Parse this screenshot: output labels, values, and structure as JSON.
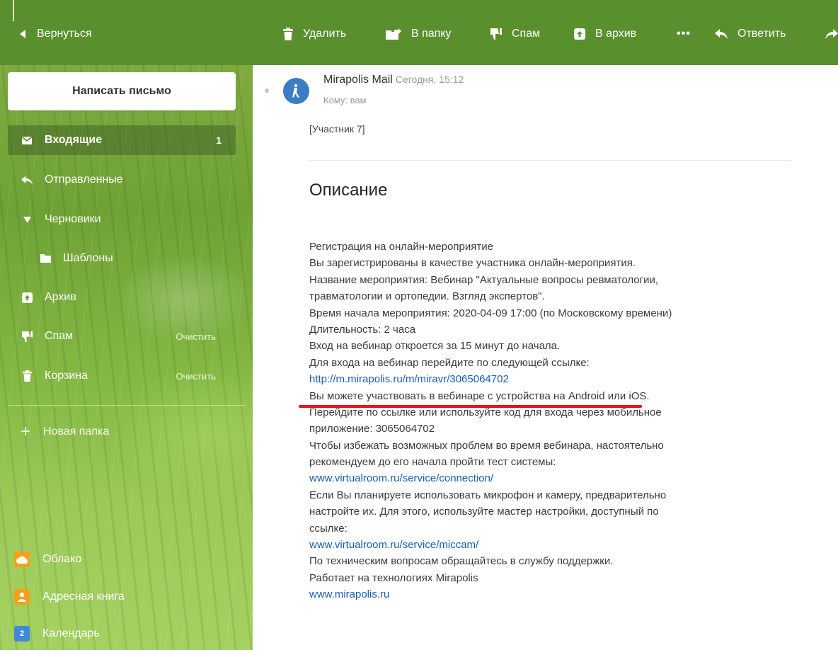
{
  "toolbar": {
    "back_label": "Вернуться",
    "delete_label": "Удалить",
    "folder_label": "В папку",
    "spam_label": "Спам",
    "archive_label": "В архив",
    "more_label": "•••",
    "reply_label": "Ответить"
  },
  "sidebar": {
    "compose_label": "Написать письмо",
    "folders": [
      {
        "label": "Входящие",
        "count": "1",
        "icon": "envelope-icon"
      },
      {
        "label": "Отправленные",
        "icon": "reply-arrow-icon"
      },
      {
        "label": "Черновики",
        "icon": "triangle-down-icon"
      },
      {
        "label": "Шаблоны",
        "icon": "folder-icon"
      },
      {
        "label": "Архив",
        "icon": "archive-icon"
      },
      {
        "label": "Спам",
        "clear": "Очистить",
        "icon": "thumb-down-icon"
      },
      {
        "label": "Корзина",
        "clear": "Очистить",
        "icon": "trash-icon"
      }
    ],
    "new_folder_label": "Новая папка",
    "apps": [
      {
        "label": "Облако",
        "color": "#f5a01a",
        "icon": "cloud-icon"
      },
      {
        "label": "Адресная книга",
        "color": "#f5a01a",
        "icon": "contact-icon"
      },
      {
        "label": "Календарь",
        "color": "#3f8ad8",
        "icon": "calendar-icon",
        "glyph": "2"
      }
    ]
  },
  "message": {
    "sender": "Mirapolis Mail",
    "date": "Сегодня, 15:12",
    "to": "Кому: вам",
    "participant": "[Участник 7]",
    "heading": "Описание",
    "lines": [
      "Регистрация на онлайн-мероприятие",
      "Вы зарегистрированы в качестве участника онлайн-мероприятия.",
      "Название мероприятия: Вебинар \"Актуальные вопросы ревматологии,",
      "травматологии и ортопедии. Взгляд экспертов\".",
      "Время начала мероприятия: 2020-04-09 17:00 (по Московскому времени)",
      "Длительность: 2 часа",
      "Вход на вебинар откроется за 15 минут до начала.",
      "Для входа на вебинар перейдите по следующей ссылке:",
      "http://m.mirapolis.ru/m/miravr/3065064702",
      "Вы можете участвовать в вебинаре с устройства на Android или iOS.",
      "Перейдите по ссылке или используйте код для входа через мобильное",
      "приложение: 3065064702",
      "Чтобы избежать возможных проблем во время вебинара, настоятельно",
      "рекомендуем до его начала пройти тест системы:",
      "www.virtualroom.ru/service/connection/",
      "Если Вы планируете использовать микрофон и камеру, предварительно",
      "настройте их. Для этого, используйте мастер настройки, доступный по",
      "ссылке:",
      "www.virtualroom.ru/service/miccam/",
      "По техническим вопросам обращайтесь в службу поддержки.",
      "Работает на технологиях Mirapolis",
      "www.mirapolis.ru"
    ]
  },
  "colors": {
    "toolbar_bg": "#5a8f2e",
    "link": "#1a5db5",
    "highlight_underline": "#e0151f"
  }
}
